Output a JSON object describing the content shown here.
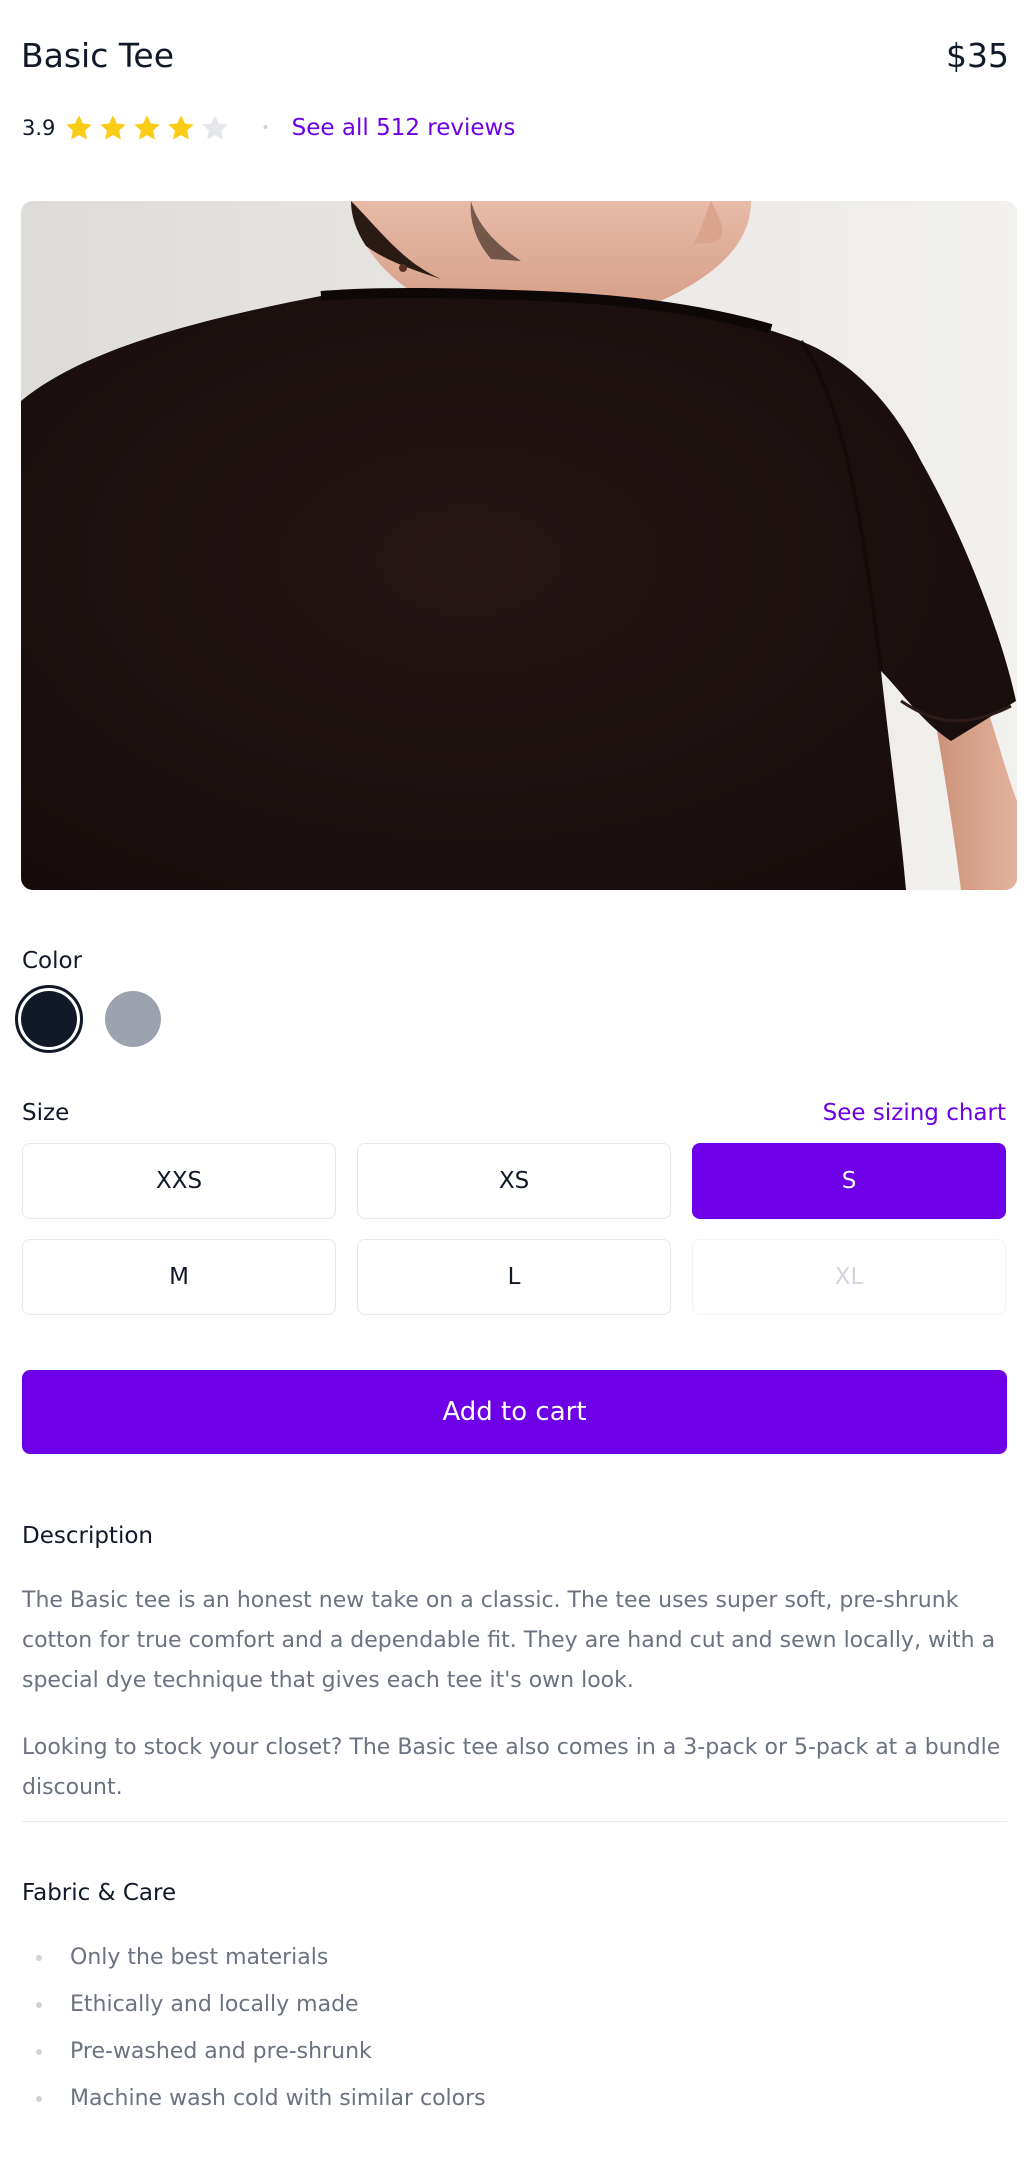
{
  "product": {
    "title": "Basic Tee",
    "price": "$35",
    "rating": {
      "value": 3.9,
      "value_label": "3.9",
      "max": 5,
      "filled_stars": 4
    },
    "reviews_link": "See all 512 reviews",
    "image_alt": "Back of model wearing black t-shirt"
  },
  "color": {
    "label": "Color",
    "options": [
      {
        "name": "Black",
        "hex": "#111827",
        "selected": true
      },
      {
        "name": "Gray",
        "hex": "#9ca3af",
        "selected": false
      }
    ]
  },
  "size": {
    "label": "Size",
    "chart_link": "See sizing chart",
    "options": [
      {
        "label": "XXS",
        "state": "available"
      },
      {
        "label": "XS",
        "state": "available"
      },
      {
        "label": "S",
        "state": "selected"
      },
      {
        "label": "M",
        "state": "available"
      },
      {
        "label": "L",
        "state": "available"
      },
      {
        "label": "XL",
        "state": "disabled"
      }
    ]
  },
  "cart": {
    "label": "Add to cart"
  },
  "description": {
    "heading": "Description",
    "paragraphs": [
      "The Basic tee is an honest new take on a classic. The tee uses super soft, pre-shrunk cotton for true comfort and a dependable fit. They are hand cut and sewn locally, with a special dye technique that gives each tee it's own look.",
      "Looking to stock your closet? The Basic tee also comes in a 3-pack or 5-pack at a bundle discount."
    ]
  },
  "fabric": {
    "heading": "Fabric & Care",
    "items": [
      "Only the best materials",
      "Ethically and locally made",
      "Pre-washed and pre-shrunk",
      "Machine wash cold with similar colors"
    ]
  },
  "colors": {
    "accent": "#6d00e6",
    "star_filled": "#facc15",
    "star_empty": "#e5e7eb",
    "text_primary": "#111827",
    "text_secondary": "#6b7280"
  }
}
